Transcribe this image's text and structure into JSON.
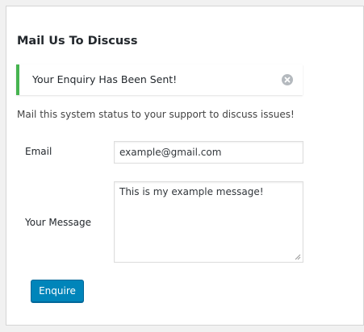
{
  "form": {
    "title": "Mail Us To Discuss",
    "notice": {
      "text": "Your Enquiry Has Been Sent!",
      "dismiss_icon": "dismiss-icon",
      "accent_color": "#46b450"
    },
    "intro": "Mail this system status to your support to discuss issues!",
    "email": {
      "label": "Email",
      "value": "example@gmail.com"
    },
    "message": {
      "label": "Your Message",
      "value": "This is my example message!"
    },
    "submit_label": "Enquire",
    "button_color": "#0085ba"
  }
}
